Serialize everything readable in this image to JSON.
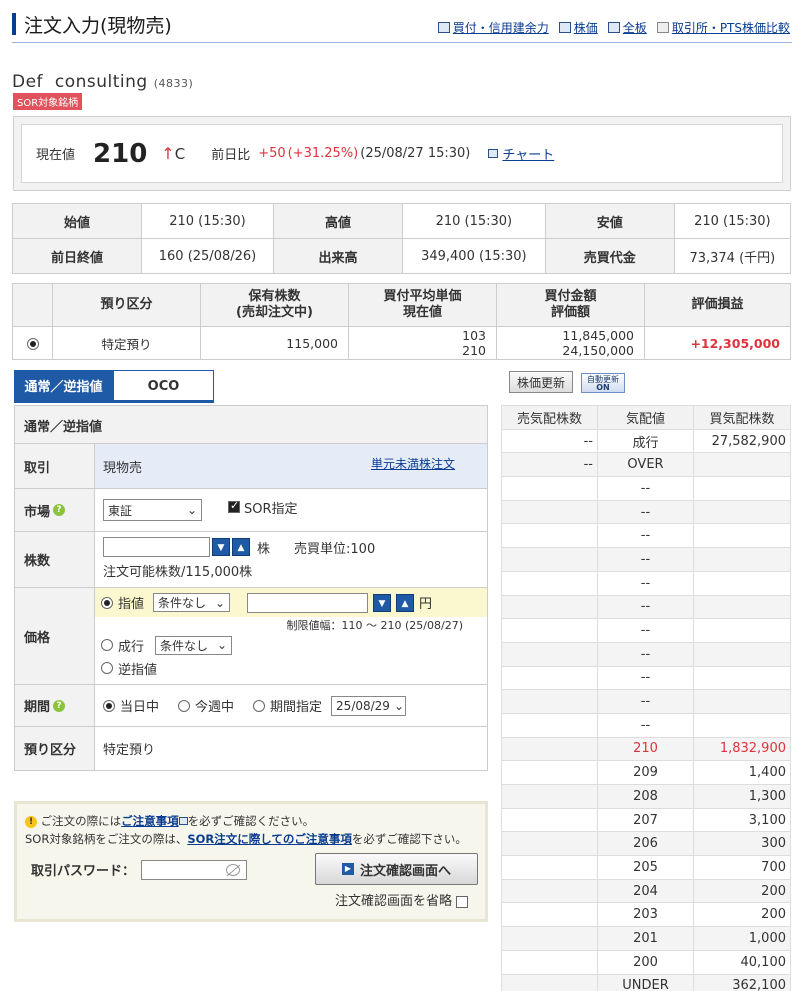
{
  "header": {
    "title": "注文入力(現物売)",
    "links": [
      "買付・信用建余力",
      "株価",
      "全板",
      "取引所・PTS株価比較"
    ]
  },
  "stock": {
    "name": "Def  consulting",
    "code": "(4833)",
    "badge": "SOR対象銘柄"
  },
  "price": {
    "label": "現在値",
    "value": "210",
    "arrow": "↑",
    "flag": "C",
    "change_label": "前日比",
    "change": "+50",
    "change_pct": "(+31.25%)",
    "time": "(25/08/27 15:30)",
    "chart_link": "チャート"
  },
  "ohlc": {
    "open_label": "始値",
    "open": "210 (15:30)",
    "high_label": "高値",
    "high": "210 (15:30)",
    "low_label": "安値",
    "low": "210 (15:30)",
    "prev_label": "前日終値",
    "prev": "160 (25/08/26)",
    "volume_label": "出来高",
    "volume": "349,400 (15:30)",
    "turnover_label": "売買代金",
    "turnover": "73,374 (千円)"
  },
  "holdings": {
    "headers": [
      "預り区分",
      "保有株数",
      "(売却注文中)",
      "買付平均単価",
      "現在値",
      "買付金額",
      "評価額",
      "評価損益"
    ],
    "row": {
      "type": "特定預り",
      "shares": "115,000",
      "avg_price": "103",
      "current": "210",
      "cost": "11,845,000",
      "value": "24,150,000",
      "pl": "+12,305,000"
    }
  },
  "tabs": {
    "normal": "通常／逆指値",
    "oco": "OCO"
  },
  "form": {
    "section_title": "通常／逆指値",
    "trade_label": "取引",
    "trade_value": "現物売",
    "odd_lot_link": "単元未満株注文",
    "market_label": "市場",
    "market_value": "東証",
    "sor_label": "SOR指定",
    "qty_label": "株数",
    "qty_value": "",
    "qty_unit": "株",
    "lot_unit": "売買単位:100",
    "available": "注文可能株数/115,000株",
    "price_label": "価格",
    "limit_label": "指値",
    "limit_cond": "条件なし",
    "price_value": "",
    "yen": "円",
    "range": "制限値幅：110 〜 210 (25/08/27)",
    "market_order_label": "成行",
    "market_cond": "条件なし",
    "stop_label": "逆指値",
    "period_label": "期間",
    "today": "当日中",
    "this_week": "今週中",
    "period_spec": "期間指定",
    "period_date": "25/08/29",
    "account_label": "預り区分",
    "account_value": "特定預り"
  },
  "board": {
    "refresh_label": "株価更新",
    "auto_label": "自動更新",
    "auto_state": "ON",
    "headers": [
      "売気配株数",
      "気配値",
      "買気配株数"
    ],
    "rows": [
      [
        "--",
        "成行",
        "27,582,900"
      ],
      [
        "--",
        "OVER",
        ""
      ],
      [
        "",
        "--",
        ""
      ],
      [
        "",
        "--",
        ""
      ],
      [
        "",
        "--",
        ""
      ],
      [
        "",
        "--",
        ""
      ],
      [
        "",
        "--",
        ""
      ],
      [
        "",
        "--",
        ""
      ],
      [
        "",
        "--",
        ""
      ],
      [
        "",
        "--",
        ""
      ],
      [
        "",
        "--",
        ""
      ],
      [
        "",
        "--",
        ""
      ],
      [
        "",
        "--",
        ""
      ],
      [
        "",
        "210",
        "1,832,900"
      ],
      [
        "",
        "209",
        "1,400"
      ],
      [
        "",
        "208",
        "1,300"
      ],
      [
        "",
        "207",
        "3,100"
      ],
      [
        "",
        "206",
        "300"
      ],
      [
        "",
        "205",
        "700"
      ],
      [
        "",
        "204",
        "200"
      ],
      [
        "",
        "203",
        "200"
      ],
      [
        "",
        "201",
        "1,000"
      ],
      [
        "",
        "200",
        "40,100"
      ],
      [
        "",
        "UNDER",
        "362,100"
      ]
    ]
  },
  "confirm": {
    "note1_pre": "ご注文の際には",
    "note1_link": "ご注意事項",
    "note1_post": "を必ずご確認ください。",
    "note2_pre": "SOR対象銘柄をご注文の際は、",
    "note2_link": "SOR注文に際してのご注意事項",
    "note2_post": "を必ずご確認下さい。",
    "pw_label": "取引パスワード：",
    "button": "注文確認画面へ",
    "skip": "注文確認画面を省略"
  },
  "colors": {
    "accent": "#1f5aa6",
    "up": "#e0323c"
  }
}
